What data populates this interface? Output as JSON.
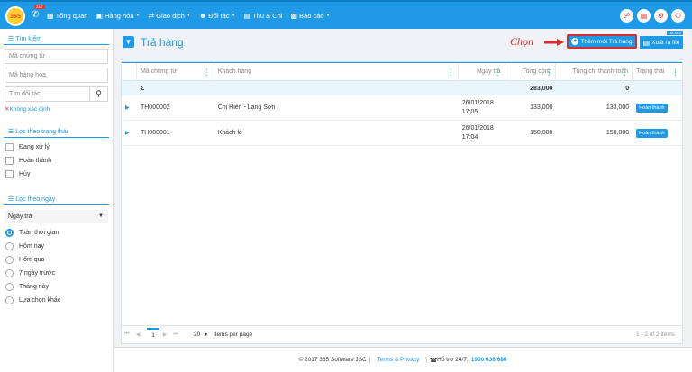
{
  "app": {
    "logo_text": "365",
    "hotline_badge": "24/7"
  },
  "nav": [
    {
      "icon": "dashboard-icon",
      "label": "Tổng quan",
      "caret": false
    },
    {
      "icon": "boxes-icon",
      "label": "Hàng hóa",
      "caret": true
    },
    {
      "icon": "exchange-icon",
      "label": "Giao dịch",
      "caret": true
    },
    {
      "icon": "users-icon",
      "label": "Đối tác",
      "caret": true
    },
    {
      "icon": "money-icon",
      "label": "Thu & Chi",
      "caret": false
    },
    {
      "icon": "chart-icon",
      "label": "Báo cáo",
      "caret": true
    }
  ],
  "top_icons": [
    "cart-icon",
    "clipboard-icon",
    "gear-icon",
    "power-icon"
  ],
  "sidebar": {
    "search_title": "Tìm kiếm",
    "search_doc_placeholder": "Mã chứng từ",
    "search_product_placeholder": "Mã hàng hóa",
    "search_partner_placeholder": "Tìm đối tác",
    "undefined_label": "Không xác định",
    "status_title": "Lọc theo trạng thái",
    "statuses": [
      "Đang xử lý",
      "Hoàn thành",
      "Hủy"
    ],
    "date_title": "Lọc theo ngày",
    "date_field": "Ngày trả",
    "date_options": [
      "Toàn thời gian",
      "Hôm nay",
      "Hôm qua",
      "7 ngày trước",
      "Tháng này",
      "Lựa chọn khác"
    ],
    "date_selected": "Toàn thời gian"
  },
  "main": {
    "title": "Trả hàng",
    "annotation": "Chọn",
    "add_button": "Thêm mới Trả hàng",
    "export_button": "Xuất ra file",
    "export_tag": "HÀ NỘI"
  },
  "table": {
    "columns": [
      "Mã chứng từ",
      "Khách hàng",
      "Ngày trả",
      "Tổng cộng",
      "Tổng chi thanh toán",
      "Trạng thái"
    ],
    "sum": {
      "symbol": "Σ",
      "total": "283,000",
      "paid": "0"
    },
    "rows": [
      {
        "code": "TH000002",
        "customer": "Chị Hiền - Lạng Sơn",
        "date": "26/01/2018",
        "time": "17:05",
        "total": "133,000",
        "paid": "133,000",
        "status": "Hoàn thành"
      },
      {
        "code": "TH000001",
        "customer": "Khách lẻ",
        "date": "26/01/2018",
        "time": "17:04",
        "total": "150,000",
        "paid": "150,000",
        "status": "Hoàn thành"
      }
    ]
  },
  "pager": {
    "page": "1",
    "page_size": "20",
    "per_page_label": "items per page",
    "info": "1 - 2 of 2 items"
  },
  "footer": {
    "copyright": "© 2017 365 Software JSC",
    "terms": "Terms & Privacy",
    "support_label": "Hỗ trợ 24/7:",
    "hotline": "1900 636 680"
  },
  "colors": {
    "primary": "#1e9ae6",
    "highlight": "#d32f2f"
  }
}
